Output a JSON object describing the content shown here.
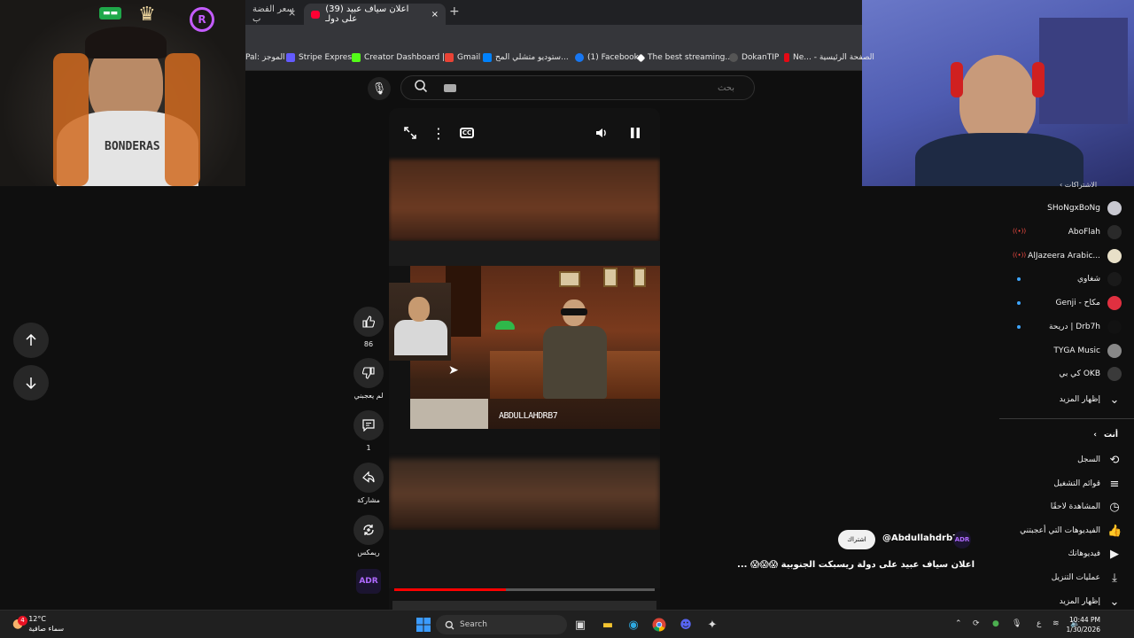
{
  "overlay": {
    "left_cam_badges": [
      "▬▬",
      "♛",
      "R"
    ],
    "left_cam_shirt": "BONDERAS"
  },
  "browser": {
    "tabs": [
      {
        "label": "سعر الفضة ب",
        "active": false
      },
      {
        "label": "(39) اعلان سياف عبيد على دولـ",
        "active": true
      }
    ],
    "new_tab": "+",
    "close": "×",
    "bookmarks": [
      "Pal: الموجز",
      "Stripe Express",
      "Creator Dashboard |...",
      "Gmail",
      "ستوديو متشلي المح...",
      "(1) Facebook",
      "The best streaming...",
      "DokanTIP",
      "Ne... - الصفحة الرئيسية"
    ]
  },
  "search": {
    "placeholder": "بحث",
    "mic_icon": "microphone-icon",
    "search_icon": "search-icon"
  },
  "player": {
    "controls": [
      "expand-icon",
      "more-icon",
      "captions-icon",
      "volume-icon",
      "pause-icon"
    ],
    "cc_label": "CC",
    "overlay_name": "ABDULLAHDRB7",
    "progress": 0.43
  },
  "actions": {
    "like_count": "86",
    "dislike_label": "لم يعجبني",
    "comments_count": "1",
    "share_label": "مشاركة",
    "remix_label": "ريمكس",
    "channel_avatar": "ADR"
  },
  "subscriptions": {
    "header": "الاشتراكات",
    "items": [
      {
        "name": "SHoNgxBoNg",
        "live": false,
        "new": false,
        "color": "#c8c8d0"
      },
      {
        "name": "AboFlah",
        "live": true,
        "new": false,
        "color": "#2a2a2a"
      },
      {
        "name": "AlJazeera Arabic...",
        "live": true,
        "new": false,
        "color": "#e8e0c8"
      },
      {
        "name": "شغاوي",
        "live": false,
        "new": true,
        "color": "#1a1a1a"
      },
      {
        "name": "Genji - مكاح",
        "live": false,
        "new": true,
        "color": "#e03040"
      },
      {
        "name": "دريحة | Drb7h",
        "live": false,
        "new": true,
        "color": "#121212"
      },
      {
        "name": "TYGA Music",
        "live": false,
        "new": false,
        "color": "#888888"
      },
      {
        "name": "كي بي OKB",
        "live": false,
        "new": false,
        "color": "#3a3a3a"
      }
    ],
    "show_more": "إظهار المزيد"
  },
  "you_section": {
    "header": "أنت",
    "items": [
      {
        "label": "السجل",
        "icon": "history-icon"
      },
      {
        "label": "قوائم التشغيل",
        "icon": "playlist-icon"
      },
      {
        "label": "المشاهدة لاحقًا",
        "icon": "watch-later-icon"
      },
      {
        "label": "الفيديوهات التي أعجبتني",
        "icon": "liked-icon"
      },
      {
        "label": "فيديوهاتك",
        "icon": "your-videos-icon"
      },
      {
        "label": "عمليات التنزيل",
        "icon": "downloads-icon"
      },
      {
        "label": "إظهار المزيد",
        "icon": "chevron-down-icon"
      }
    ]
  },
  "video_info": {
    "subscribe_label": "اشتراك",
    "handle": "@Abdullahdrb7",
    "avatar": "ADR",
    "title": "اعلان سياف عبيد على دولة ريسبكت الجنوبية 😱😱😱 ..."
  },
  "taskbar": {
    "weather_temp": "12°C",
    "weather_desc": "سماء صافية",
    "weather_badge": "4",
    "search_label": "Search",
    "time": "10:44 PM",
    "date": "1/30/2026",
    "lang": "ع"
  },
  "colors": {
    "accent": "#ff0000",
    "background": "#0f0f0f",
    "link": "#3ea6ff"
  }
}
